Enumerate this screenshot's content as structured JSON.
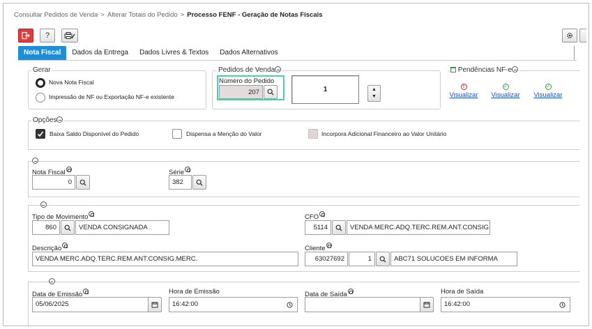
{
  "breadcrumb": {
    "item1": "Consultar Pedidos de Venda",
    "item2": "Alterar Totais do Pedido",
    "current": "Processo FENF - Geração de Notas Fiscais",
    "separator": ">"
  },
  "tabs": [
    "Nota Fiscal",
    "Dados da Entrega",
    "Dados Livres & Textos",
    "Dados Alternativos"
  ],
  "gerar": {
    "legend": "Gerar",
    "opt1": "Nova Nota Fiscal",
    "opt2": "Impressão de NF ou Exportação NF-e existente"
  },
  "pedidos": {
    "legend": "Pedidos de Venda",
    "numero_label": "Número do Pedido",
    "numero_value": "207",
    "count_value": "1"
  },
  "pendencias": {
    "legend": "Pendências NF-e",
    "link": "Visualizar"
  },
  "opcoes": {
    "legend": "Opções",
    "opt1": "Baixa Saldo Disponível do Pedido",
    "opt2": "Dispensa a Menção do Valor",
    "opt3": "Incorpora Adicional Financeiro ao Valor Unitário"
  },
  "nota": {
    "nf_label": "Nota Fiscal",
    "nf_value": "0",
    "serie_label": "Série",
    "serie_value": "382"
  },
  "movimento": {
    "tipo_label": "Tipo de Movimento",
    "tipo_code": "860",
    "tipo_desc": "VENDA CONSIGNADA",
    "cfo_label": "CFO",
    "cfo_code": "5114",
    "cfo_desc": "VENDA MERC.ADQ.TERC.REM.ANT.CONSIG.MERC.",
    "desc_label": "Descrição",
    "desc_value": "VENDA MERC.ADQ.TERC.REM.ANT.CONSIG.MERC.",
    "cliente_label": "Cliente",
    "cliente_code": "63027692",
    "cliente_seq": "1",
    "cliente_name": "ABC71 SOLUCOES EM INFORMA"
  },
  "datas": {
    "emissao_label": "Data de Emissão",
    "emissao_value": "05/06/2025",
    "hora_emissao_label": "Hora de Emissão",
    "hora_emissao_value": "16:42:00",
    "saida_label": "Data de Saída",
    "saida_value": "",
    "hora_saida_label": "Hora de Saída",
    "hora_saida_value": "16:42:00"
  },
  "colors": {
    "accent": "#1e8fd6",
    "exit_button": "#e23a3a",
    "focus_border": "#3dd6a4",
    "link": "#1a4fb8",
    "error": "#e02020",
    "ok": "#2e9e3a"
  }
}
